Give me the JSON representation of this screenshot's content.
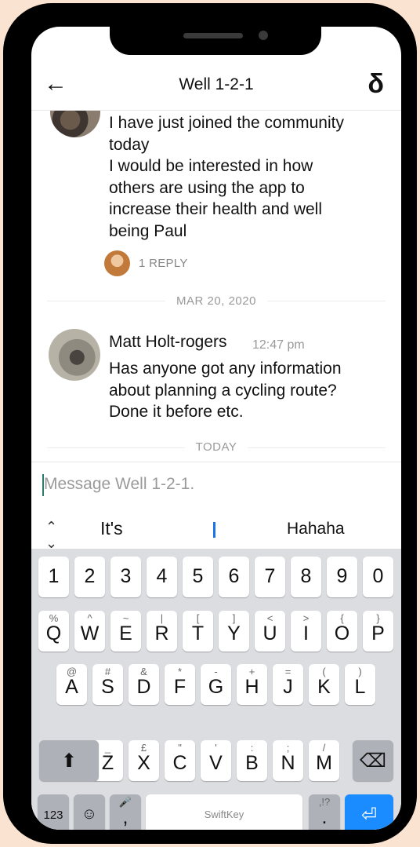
{
  "header": {
    "back_icon": "arrow-left-icon",
    "title": "Well 1-2-1",
    "brand_icon": "brand-logo-icon"
  },
  "feed": {
    "message1": {
      "text": "I have just joined the community\ntoday\nI would be interested in how\nothers are using the app to\nincrease their health and well\nbeing Paul"
    },
    "reply": {
      "label": "1 REPLY"
    },
    "date_divider": "MAR 20, 2020",
    "message2": {
      "author": "Matt Holt-rogers",
      "time": "12:47 pm",
      "text": "Has anyone got any information\nabout planning a cycling route?\nDone it before etc."
    },
    "today_divider": "TODAY"
  },
  "composer": {
    "placeholder": "Message Well 1-2-1.",
    "value": ""
  },
  "suggestions": {
    "left": "It's",
    "right": "Hahaha"
  },
  "keyboard": {
    "numbers": [
      "1",
      "2",
      "3",
      "4",
      "5",
      "6",
      "7",
      "8",
      "9",
      "0"
    ],
    "row1": {
      "keys": [
        "Q",
        "W",
        "E",
        "R",
        "T",
        "Y",
        "U",
        "I",
        "O",
        "P"
      ],
      "alts": [
        "%",
        "^",
        "~",
        "|",
        "[",
        "]",
        "<",
        ">",
        "{",
        "}"
      ]
    },
    "row2": {
      "keys": [
        "A",
        "S",
        "D",
        "F",
        "G",
        "H",
        "J",
        "K",
        "L"
      ],
      "alts": [
        "@",
        "#",
        "&",
        "*",
        "-",
        "+",
        "=",
        "(",
        ")"
      ]
    },
    "row3": {
      "keys": [
        "Z",
        "X",
        "C",
        "V",
        "B",
        "N",
        "M"
      ],
      "alts": [
        "_",
        "£",
        "\"",
        "'",
        ":",
        ";",
        "/"
      ]
    },
    "bottom": {
      "num_label": "123",
      "comma": ",",
      "space_label": "SwiftKey",
      "period": ".",
      "punct_alt": ",!?"
    }
  },
  "colors": {
    "accent": "#1a8cff",
    "caret": "#2b7a6d",
    "keyboard_bg": "#dcdde1",
    "frame_bg": "#fbe3d2"
  }
}
